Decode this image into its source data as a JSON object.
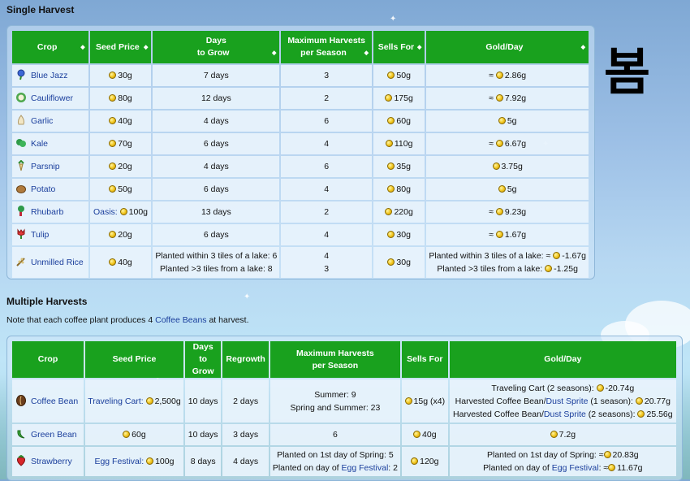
{
  "section1": {
    "title": "Single Harvest",
    "season_label": "봄",
    "headers": [
      "Crop",
      "Seed Price",
      "Days to Grow",
      "Maximum Harvests per Season",
      "Sells For",
      "Gold/Day"
    ],
    "header_lines": {
      "days_1": "Days",
      "days_2": "to Grow",
      "max_1": "Maximum Harvests",
      "max_2": "per Season"
    },
    "rows": [
      {
        "crop": "Blue Jazz",
        "icon": "blue-jazz-icon",
        "seed": "30g",
        "days": "7 days",
        "max": "3",
        "sells": "50g",
        "gpd": "≈",
        "gpd_val": "2.86g"
      },
      {
        "crop": "Cauliflower",
        "icon": "cauliflower-icon",
        "seed": "80g",
        "days": "12 days",
        "max": "2",
        "sells": "175g",
        "gpd": "≈",
        "gpd_val": "7.92g"
      },
      {
        "crop": "Garlic",
        "icon": "garlic-icon",
        "seed": "40g",
        "days": "4 days",
        "max": "6",
        "sells": "60g",
        "gpd": "",
        "gpd_val": "5g"
      },
      {
        "crop": "Kale",
        "icon": "kale-icon",
        "seed": "70g",
        "days": "6 days",
        "max": "4",
        "sells": "110g",
        "gpd": "≈",
        "gpd_val": "6.67g"
      },
      {
        "crop": "Parsnip",
        "icon": "parsnip-icon",
        "seed": "20g",
        "days": "4 days",
        "max": "6",
        "sells": "35g",
        "gpd": "",
        "gpd_val": "3.75g"
      },
      {
        "crop": "Potato",
        "icon": "potato-icon",
        "seed": "50g",
        "days": "6 days",
        "max": "4",
        "sells": "80g",
        "gpd": "",
        "gpd_val": "5g"
      },
      {
        "crop": "Rhubarb",
        "icon": "rhubarb-icon",
        "seed_prefix": "Oasis:",
        "seed": "100g",
        "days": "13 days",
        "max": "2",
        "sells": "220g",
        "gpd": "≈",
        "gpd_val": "9.23g"
      },
      {
        "crop": "Tulip",
        "icon": "tulip-icon",
        "seed": "20g",
        "days": "6 days",
        "max": "4",
        "sells": "30g",
        "gpd": "≈",
        "gpd_val": "1.67g"
      }
    ],
    "rice": {
      "crop": "Unmilled Rice",
      "icon": "rice-icon",
      "seed": "40g",
      "days_1": "Planted within 3 tiles of a lake: 6",
      "days_2": "Planted >3 tiles from a lake: 8",
      "max_1": "4",
      "max_2": "3",
      "sells": "30g",
      "gpd_1_label": "Planted within 3 tiles of a lake: ≈",
      "gpd_1_val": "-1.67g",
      "gpd_2_label": "Planted >3 tiles from a lake:",
      "gpd_2_val": "-1.25g"
    }
  },
  "section2": {
    "title": "Multiple Harvests",
    "note_prefix": "Note that each coffee plant produces 4 ",
    "note_link": "Coffee Beans",
    "note_suffix": " at harvest.",
    "headers": {
      "crop": "Crop",
      "seed": "Seed Price",
      "days_1": "Days",
      "days_2": "to Grow",
      "regrowth": "Regrowth",
      "max_1": "Maximum Harvests",
      "max_2": "per Season",
      "sells": "Sells For",
      "gpd": "Gold/Day"
    },
    "coffee": {
      "crop": "Coffee Bean",
      "seed_link": "Traveling Cart:",
      "seed": "2,500g",
      "days": "10 days",
      "regrowth": "2 days",
      "max_1": "Summer: 9",
      "max_2": "Spring and Summer: 23",
      "sells": "15g",
      "sells_mult": "(x4)",
      "gpd_1_label": "Traveling Cart (2 seasons):",
      "gpd_1_val": "-20.74g",
      "gpd_2_label": "Harvested Coffee Bean/",
      "gpd_2_link": "Dust Sprite",
      "gpd_2_suffix": " (1 season):",
      "gpd_2_val": "20.77g",
      "gpd_3_label": "Harvested Coffee Bean/",
      "gpd_3_link": "Dust Sprite",
      "gpd_3_suffix": " (2 seasons):",
      "gpd_3_val": "25.56g"
    },
    "greenbean": {
      "crop": "Green Bean",
      "seed": "60g",
      "days": "10 days",
      "regrowth": "3 days",
      "max": "6",
      "sells": "40g",
      "gpd_val": "7.2g"
    },
    "strawberry": {
      "crop": "Strawberry",
      "seed_link": "Egg Festival:",
      "seed": "100g",
      "days": "8 days",
      "regrowth": "4 days",
      "max_1": "Planted on 1st day of Spring: 5",
      "max_2_prefix": "Planted on day of ",
      "max_2_link": "Egg Festival",
      "max_2_suffix": ": 2",
      "sells": "120g",
      "gpd_1_label": "Planted on 1st day of Spring: ≈",
      "gpd_1_val": "20.83g",
      "gpd_2_prefix": "Planted on day of ",
      "gpd_2_link": "Egg Festival",
      "gpd_2_suffix": ": ≈",
      "gpd_2_val": "11.67g"
    }
  }
}
